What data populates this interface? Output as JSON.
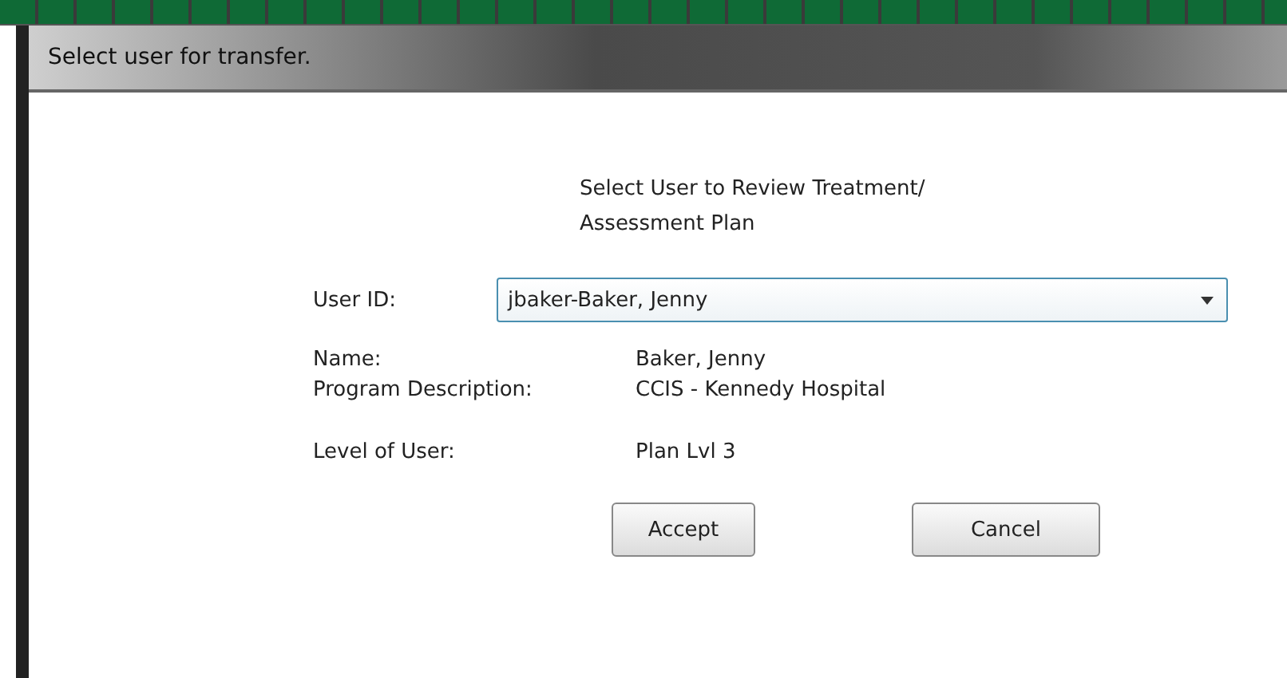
{
  "window": {
    "title": "Select user for transfer."
  },
  "heading": "Select User to Review Treatment/ Assessment Plan",
  "user_id": {
    "label": "User ID:",
    "value": "jbaker-Baker, Jenny"
  },
  "fields": [
    {
      "label": "Name:",
      "value": "Baker, Jenny"
    },
    {
      "label": "Program Description:",
      "value": "CCIS - Kennedy Hospital"
    },
    {
      "label": "Level of User:",
      "value": "Plan Lvl 3"
    }
  ],
  "buttons": [
    "Accept",
    "Cancel"
  ]
}
